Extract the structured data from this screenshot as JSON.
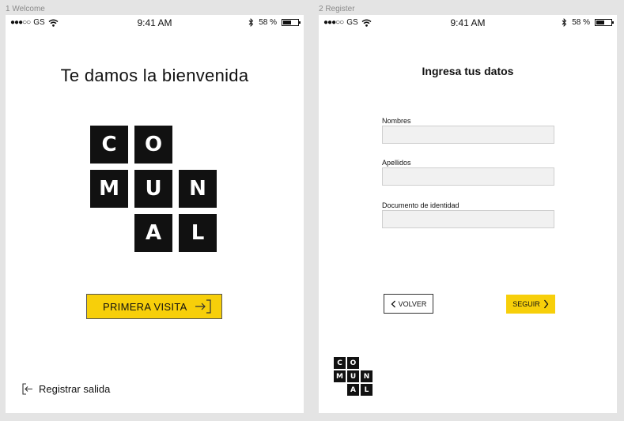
{
  "artboards": [
    {
      "label": "1 Welcome"
    },
    {
      "label": "2 Register"
    }
  ],
  "status_bar": {
    "signal_dots": "●●●○○",
    "carrier": "GS",
    "time": "9:41 AM",
    "battery_text": "58 %",
    "battery_level": 0.58
  },
  "logo": {
    "tiles": [
      "C",
      "O",
      "M",
      "U",
      "N",
      "A",
      "L"
    ]
  },
  "welcome": {
    "title": "Te damos la bienvenida",
    "primary_button": "PRIMERA VISITA",
    "signout_link": "Registrar salida"
  },
  "register": {
    "title": "Ingresa tus datos",
    "fields": [
      {
        "label": "Nombres",
        "value": ""
      },
      {
        "label": "Apellidos",
        "value": ""
      },
      {
        "label": "Documento de identidad",
        "value": ""
      }
    ],
    "back_button": "VOLVER",
    "next_button": "SEGUIR"
  },
  "colors": {
    "accent": "#f7cf0a",
    "tile": "#111111",
    "background": "#e4e4e4"
  }
}
